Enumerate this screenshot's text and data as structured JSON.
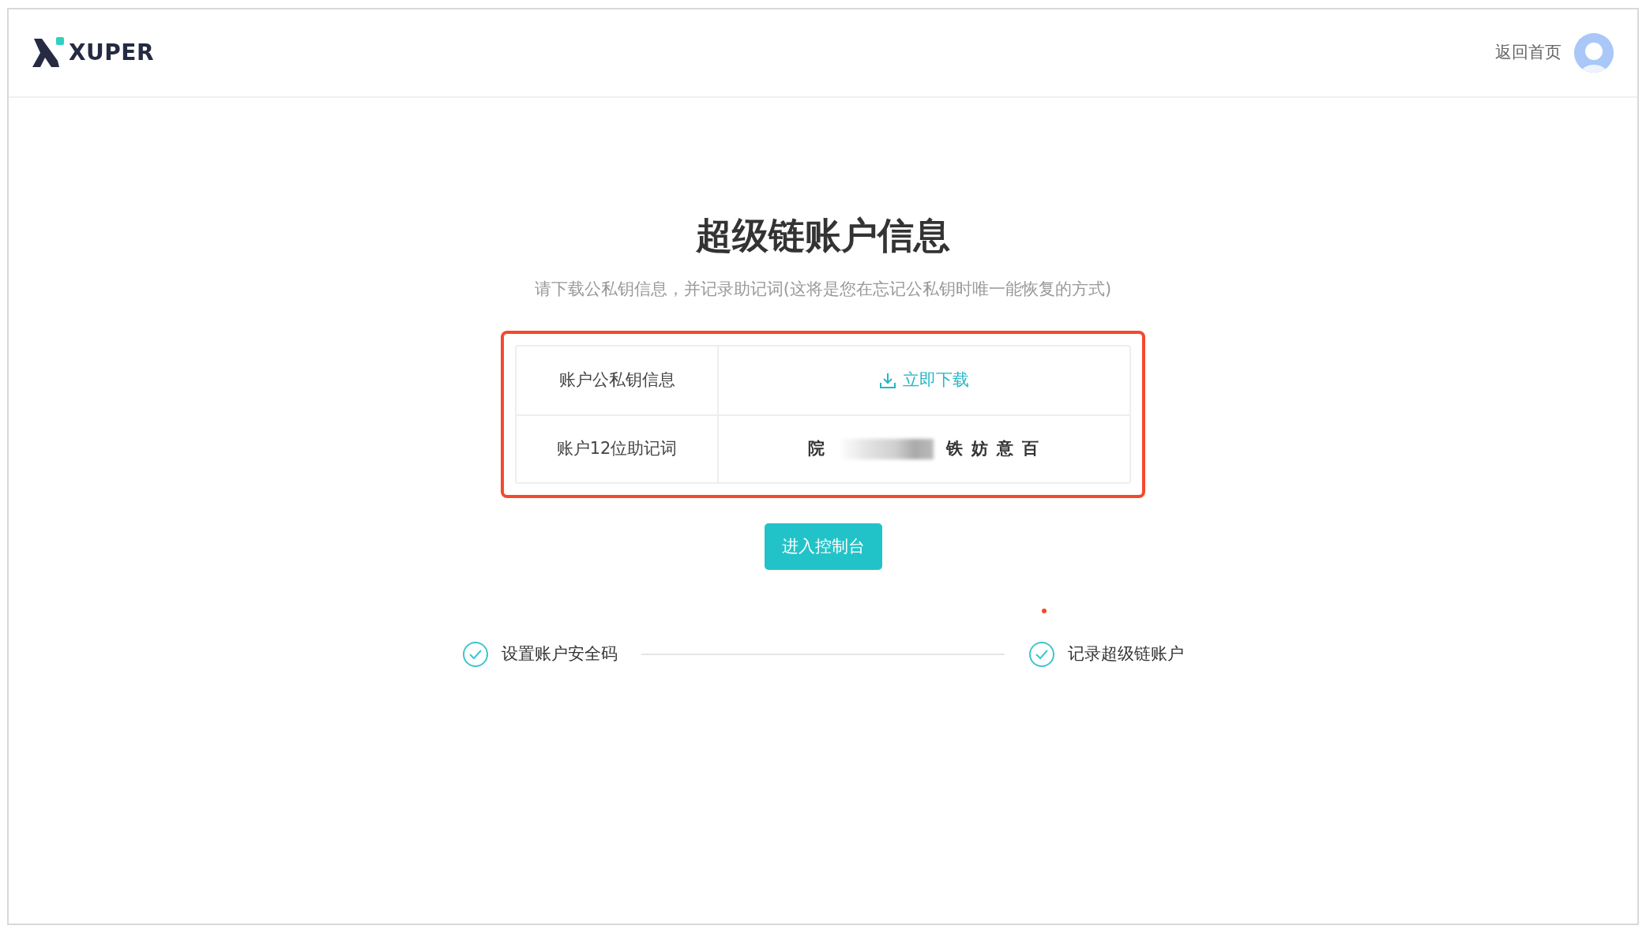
{
  "header": {
    "logo_text": "XUPER",
    "home_link": "返回首页"
  },
  "title": "超级链账户信息",
  "subtitle": "请下载公私钥信息，并记录助记词(这将是您在忘记公私钥时唯一能恢复的方式)",
  "highlighted": true,
  "table": {
    "rows": [
      {
        "kind": "download",
        "label": "账户公私钥信息",
        "action": "立即下载"
      },
      {
        "kind": "mnemonic",
        "label": "账户12位助记词",
        "visible_start": "院",
        "visible_end": "铁 妨 意 百",
        "redacted": true
      }
    ]
  },
  "console_button": "进入控制台",
  "steps": [
    {
      "label": "设置账户安全码",
      "completed": true
    },
    {
      "label": "记录超级链账户",
      "completed": true
    }
  ]
}
